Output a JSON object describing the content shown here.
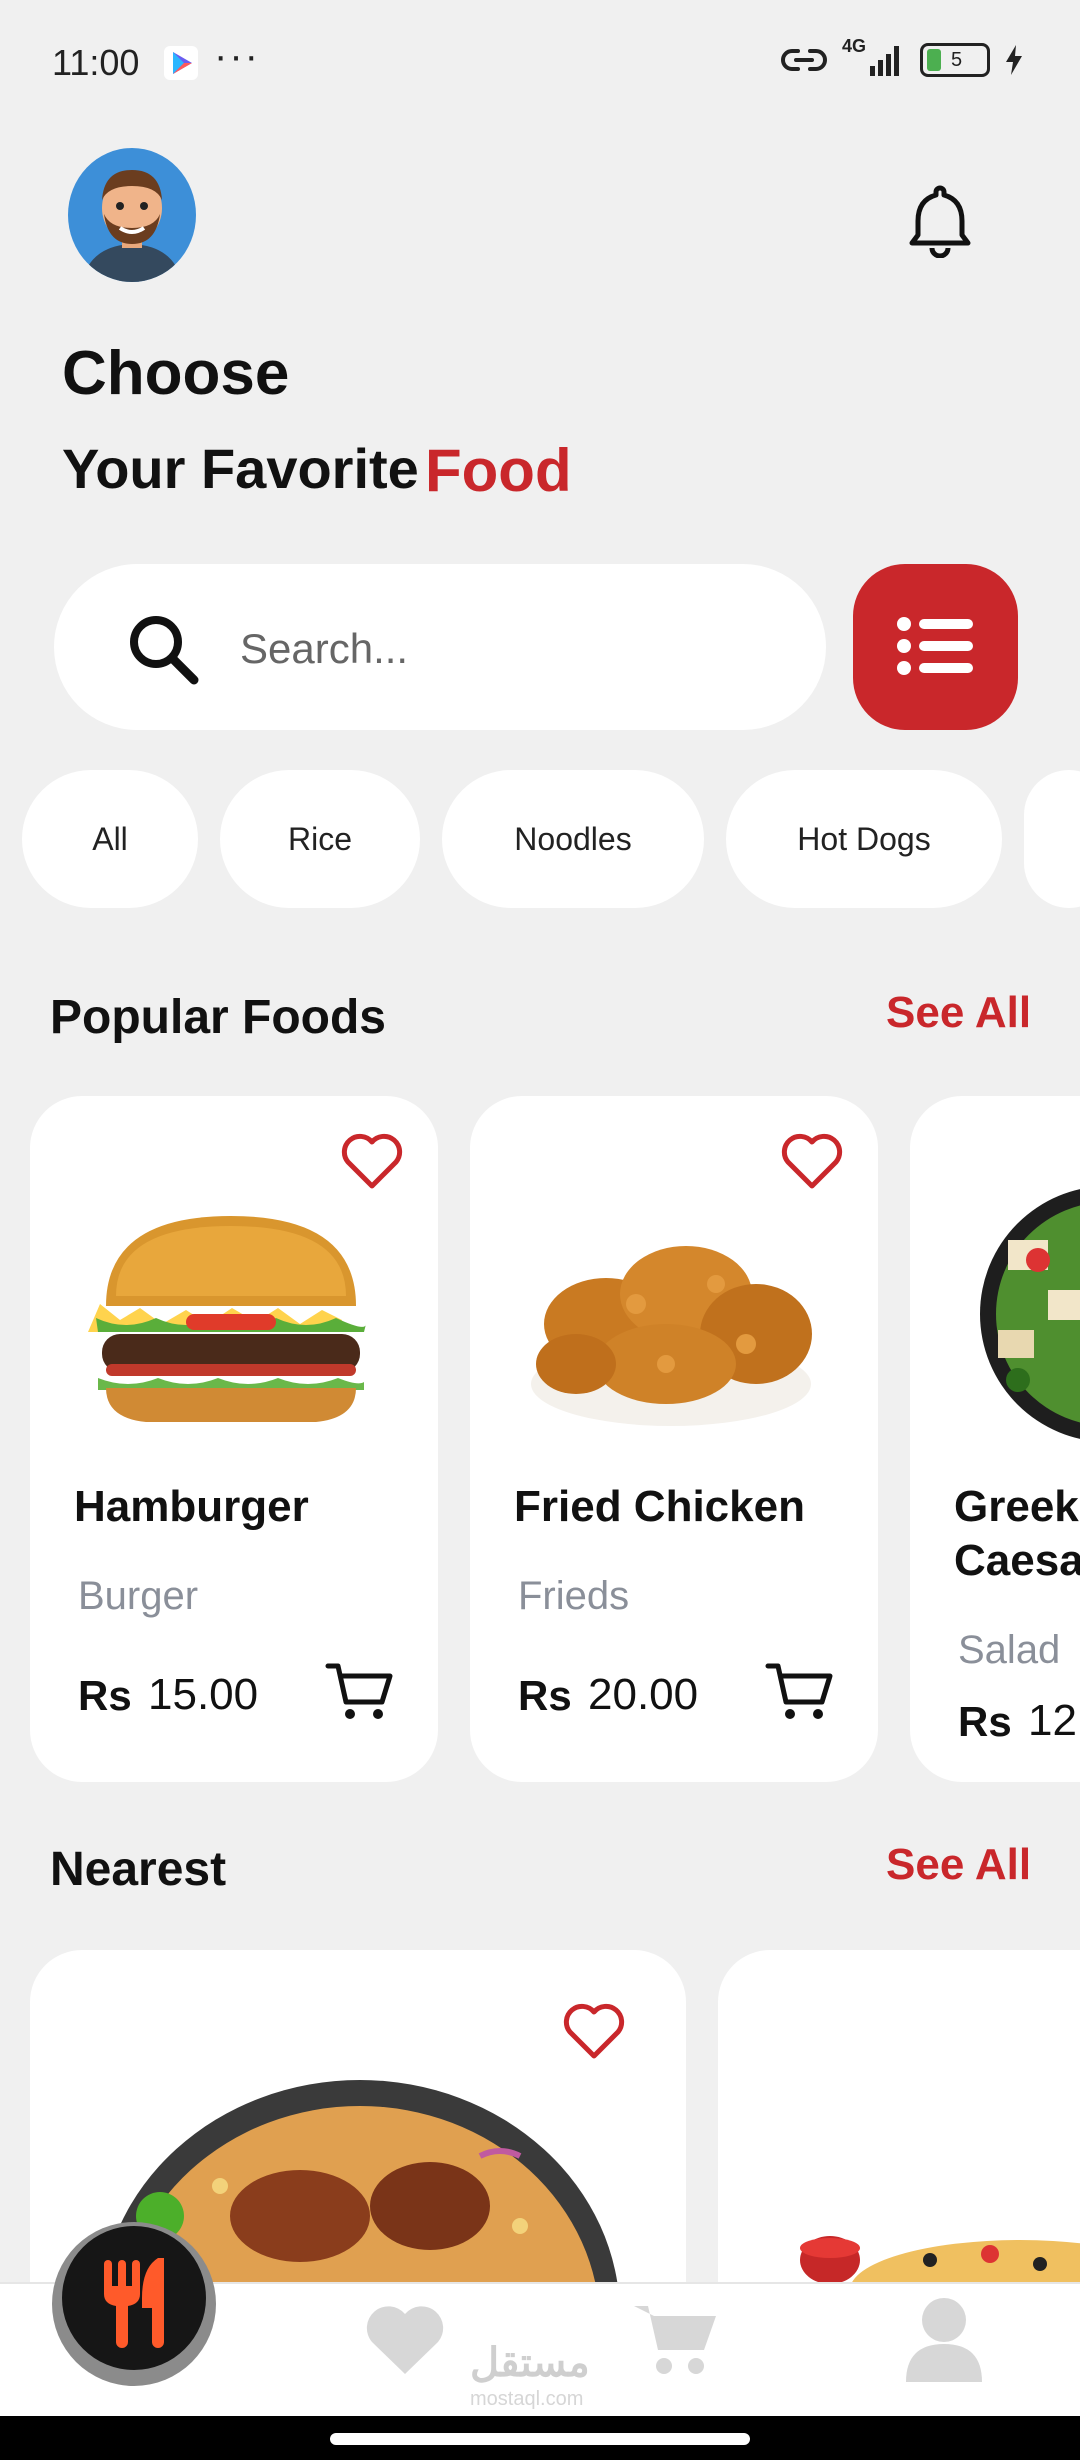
{
  "status_bar": {
    "time": "11:00",
    "dots": "···",
    "network": "4G",
    "battery": "5"
  },
  "header": {
    "title_line1": "Choose",
    "title_line2": "Your Favorite",
    "title_accent": "Food"
  },
  "search": {
    "placeholder": "Search..."
  },
  "categories": [
    "All",
    "Rice",
    "Noodles",
    "Hot Dogs"
  ],
  "popular": {
    "title": "Popular Foods",
    "see_all": "See All",
    "items": [
      {
        "name": "Hamburger",
        "category": "Burger",
        "currency": "Rs",
        "price": "15.00"
      },
      {
        "name": "Fried Chicken",
        "category": "Frieds",
        "currency": "Rs",
        "price": "20.00"
      },
      {
        "name_line1": "Greek",
        "name_line2": "Caesa",
        "category": "Salad",
        "currency": "Rs",
        "price": "12"
      }
    ]
  },
  "nearest": {
    "title": "Nearest",
    "see_all": "See All"
  },
  "watermark": {
    "text": "مستقل",
    "sub": "mostaql.com"
  },
  "colors": {
    "accent": "#c9272b",
    "background": "#f0f0f0",
    "card": "#ffffff"
  }
}
